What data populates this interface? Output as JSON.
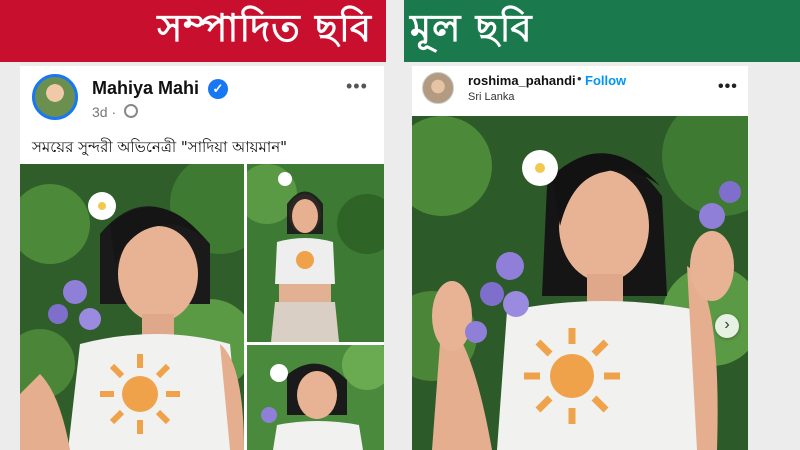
{
  "banners": {
    "edited_label": "সম্পাদিত ছবি",
    "original_label": "মূল ছবি"
  },
  "left_post": {
    "author": "Mahiya Mahi",
    "verified_icon": "verified-badge-icon",
    "time": "3d ·",
    "caption": "সময়ের সুন্দরী অভিনেত্রী \"সাদিয়া আয়মান\"",
    "more_label": "•••"
  },
  "right_post": {
    "username": "roshima_pahandi",
    "separator": "•",
    "follow_label": "Follow",
    "location": "Sri Lanka",
    "more_label": "•••",
    "next_label": "›"
  },
  "colors": {
    "edited_banner": "#c8102e",
    "original_banner": "#1b7a4d",
    "facebook_blue": "#1877f2",
    "instagram_blue": "#0095f6"
  }
}
